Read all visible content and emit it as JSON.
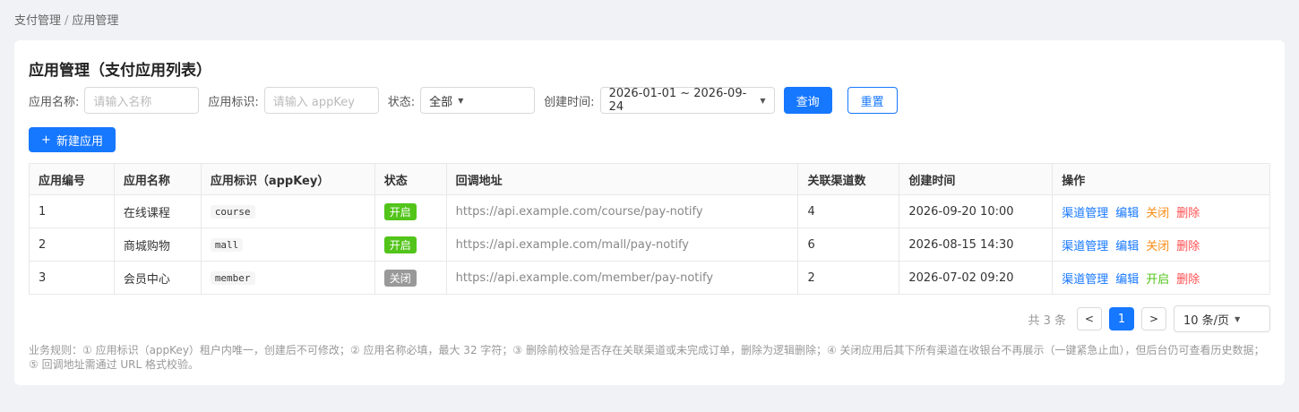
{
  "breadcrumb": {
    "parent": "支付管理",
    "separator": "/",
    "current": "应用管理"
  },
  "title": "应用管理（支付应用列表）",
  "filters": {
    "name_label": "应用名称:",
    "name_placeholder": "请输入名称",
    "key_label": "应用标识:",
    "key_placeholder": "请输入 appKey",
    "status_label": "状态:",
    "status_value": "全部",
    "time_label": "创建时间:",
    "time_value": "2026-01-01 ~ 2026-09-24",
    "query_label": "查询",
    "reset_label": "重置"
  },
  "new_button": {
    "icon": "plus-icon",
    "label": "新建应用"
  },
  "table": {
    "headers": [
      "应用编号",
      "应用名称",
      "应用标识（appKey）",
      "状态",
      "回调地址",
      "关联渠道数",
      "创建时间",
      "操作"
    ],
    "rows": [
      {
        "id": "1",
        "name": "在线课程",
        "key": "course",
        "status": "开启",
        "status_color": "#52c41a",
        "url": "https://api.example.com/course/pay-notify",
        "channels": "4",
        "created": "2026-09-20 10:00",
        "actions": [
          {
            "label": "渠道管理",
            "color": "#1677ff"
          },
          {
            "label": "编辑",
            "color": "#1677ff"
          },
          {
            "label": "关闭",
            "color": "#fa8c16"
          },
          {
            "label": "删除",
            "color": "#ff4d4f"
          }
        ]
      },
      {
        "id": "2",
        "name": "商城购物",
        "key": "mall",
        "status": "开启",
        "status_color": "#52c41a",
        "url": "https://api.example.com/mall/pay-notify",
        "channels": "6",
        "created": "2026-08-15 14:30",
        "actions": [
          {
            "label": "渠道管理",
            "color": "#1677ff"
          },
          {
            "label": "编辑",
            "color": "#1677ff"
          },
          {
            "label": "关闭",
            "color": "#fa8c16"
          },
          {
            "label": "删除",
            "color": "#ff4d4f"
          }
        ]
      },
      {
        "id": "3",
        "name": "会员中心",
        "key": "member",
        "status": "关闭",
        "status_color": "#999999",
        "url": "https://api.example.com/member/pay-notify",
        "channels": "2",
        "created": "2026-07-02 09:20",
        "actions": [
          {
            "label": "渠道管理",
            "color": "#1677ff"
          },
          {
            "label": "编辑",
            "color": "#1677ff"
          },
          {
            "label": "开启",
            "color": "#52c41a"
          },
          {
            "label": "删除",
            "color": "#ff4d4f"
          }
        ]
      }
    ]
  },
  "pagination": {
    "total": "共 3 条",
    "prev": "<",
    "current": "1",
    "next": ">",
    "page_size": "10 条/页"
  },
  "rules": "业务规则：① 应用标识（appKey）租户内唯一，创建后不可修改；② 应用名称必填，最大 32 字符；③ 删除前校验是否存在关联渠道或未完成订单，删除为逻辑删除；④ 关闭应用后其下所有渠道在收银台不再展示（一键紧急止血），但后台仍可查看历史数据；⑤ 回调地址需通过 URL 格式校验。"
}
